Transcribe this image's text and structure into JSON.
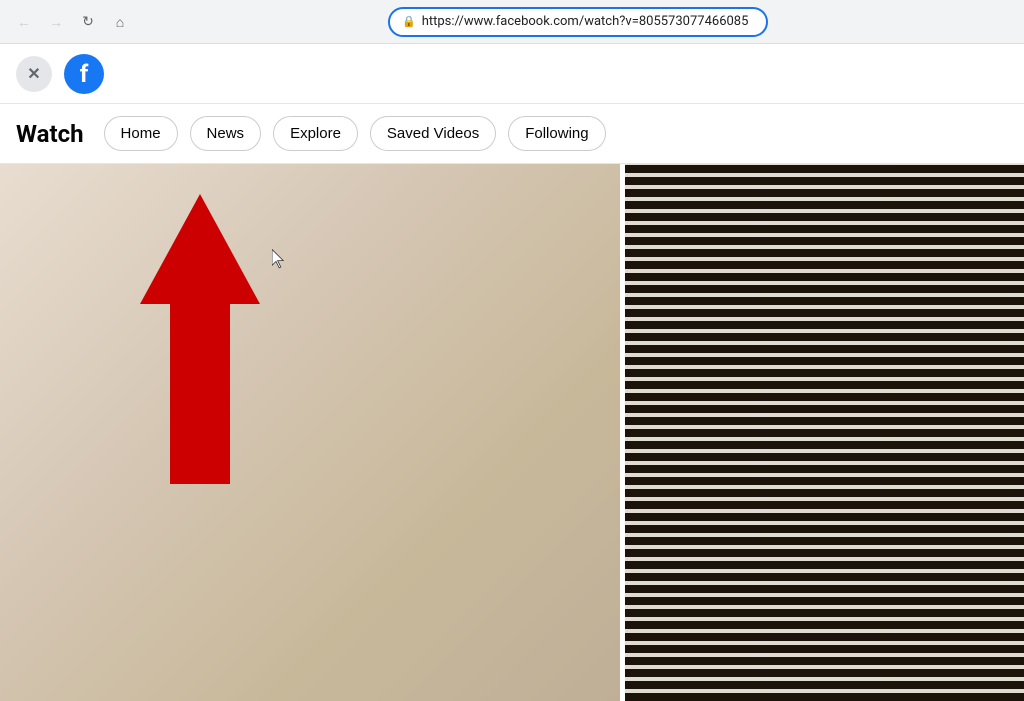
{
  "browser": {
    "back_btn": "←",
    "forward_btn": "→",
    "refresh_btn": "↻",
    "home_btn": "⌂",
    "address": "https://www.facebook.com/watch?v=805573077466085",
    "lock_icon": "🔒"
  },
  "facebook": {
    "close_btn": "✕",
    "logo_letter": "f",
    "watch_title": "Watch",
    "nav_items": [
      {
        "label": "Home",
        "id": "home"
      },
      {
        "label": "News",
        "id": "news"
      },
      {
        "label": "Explore",
        "id": "explore"
      },
      {
        "label": "Saved Videos",
        "id": "saved-videos"
      },
      {
        "label": "Following",
        "id": "following"
      }
    ]
  },
  "content": {
    "arrow_color": "#cc0000"
  }
}
